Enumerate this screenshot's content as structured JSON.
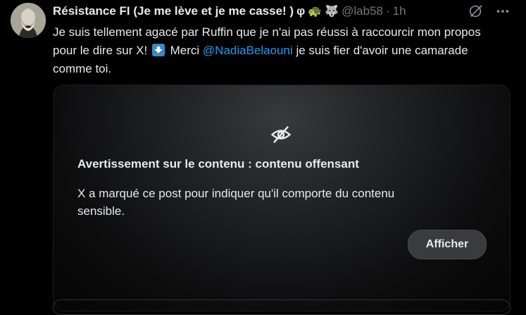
{
  "post": {
    "display_name": "Résistance FI (Je me lève et je me casse! )",
    "name_suffix": "φ",
    "emojis": [
      "🐢",
      "🐺"
    ],
    "handle": "@lab58",
    "separator": "·",
    "time": "1h",
    "text_part1": "Je suis tellement agacé par Ruffin que je n'ai pas réussi à raccourcir mon propos pour le dire sur X! ",
    "text_part2": " Merci ",
    "mention": "@NadiaBelaouni",
    "text_part3": " je suis fier d'avoir une camarade comme toi."
  },
  "warning": {
    "title": "Avertissement sur le contenu : contenu offensant",
    "body": "X a marqué ce post pour indiquer qu'il comporte du contenu sensible.",
    "show_label": "Afficher"
  },
  "colors": {
    "background": "#000000",
    "text": "#e7e9ea",
    "muted": "#71767b",
    "link": "#1d9bf0"
  }
}
